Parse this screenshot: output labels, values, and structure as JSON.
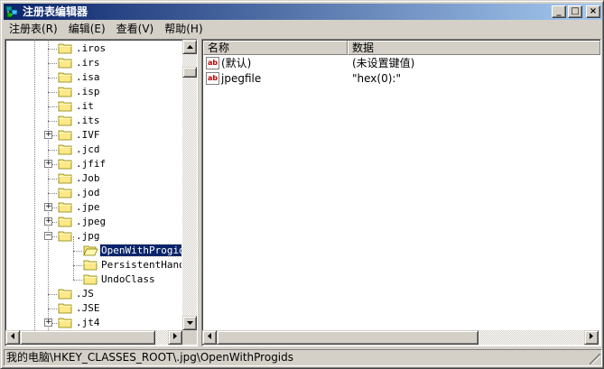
{
  "window": {
    "title": "注册表编辑器"
  },
  "title_buttons": {
    "minimize": "_",
    "maximize": "□",
    "close": "×"
  },
  "menu": [
    {
      "label": "注册表(R)"
    },
    {
      "label": "编辑(E)"
    },
    {
      "label": "查看(V)"
    },
    {
      "label": "帮助(H)"
    }
  ],
  "tree": {
    "items": [
      {
        "label": ".iros",
        "expandable": false,
        "level": 1
      },
      {
        "label": ".irs",
        "expandable": false,
        "level": 1
      },
      {
        "label": ".isa",
        "expandable": false,
        "level": 1
      },
      {
        "label": ".isp",
        "expandable": false,
        "level": 1
      },
      {
        "label": ".it",
        "expandable": false,
        "level": 1
      },
      {
        "label": ".its",
        "expandable": false,
        "level": 1
      },
      {
        "label": ".IVF",
        "expandable": true,
        "level": 1
      },
      {
        "label": ".jcd",
        "expandable": false,
        "level": 1
      },
      {
        "label": ".jfif",
        "expandable": true,
        "level": 1
      },
      {
        "label": ".Job",
        "expandable": false,
        "level": 1
      },
      {
        "label": ".jod",
        "expandable": false,
        "level": 1
      },
      {
        "label": ".jpe",
        "expandable": true,
        "level": 1
      },
      {
        "label": ".jpeg",
        "expandable": true,
        "level": 1
      },
      {
        "label": ".jpg",
        "expandable": "open",
        "level": 1
      },
      {
        "label": "OpenWithProgids",
        "expandable": false,
        "level": 2,
        "selected": true
      },
      {
        "label": "PersistentHandler",
        "expandable": false,
        "level": 2
      },
      {
        "label": "UndoClass",
        "expandable": false,
        "level": 2
      },
      {
        "label": ".JS",
        "expandable": false,
        "level": 1
      },
      {
        "label": ".JSE",
        "expandable": false,
        "level": 1
      },
      {
        "label": ".jt4",
        "expandable": true,
        "level": 1
      }
    ]
  },
  "list": {
    "columns": {
      "name": "名称",
      "data": "数据"
    },
    "rows": [
      {
        "icon": "ab",
        "name": "(默认)",
        "data": "(未设置键值)"
      },
      {
        "icon": "ab",
        "name": "jpegfile",
        "data": "\"hex(0):\""
      }
    ]
  },
  "status": {
    "path": "我的电脑\\HKEY_CLASSES_ROOT\\.jpg\\OpenWithProgids"
  },
  "colors": {
    "titlebar": "#0a246a",
    "selection": "#0a246a",
    "face": "#d4d0c8"
  }
}
